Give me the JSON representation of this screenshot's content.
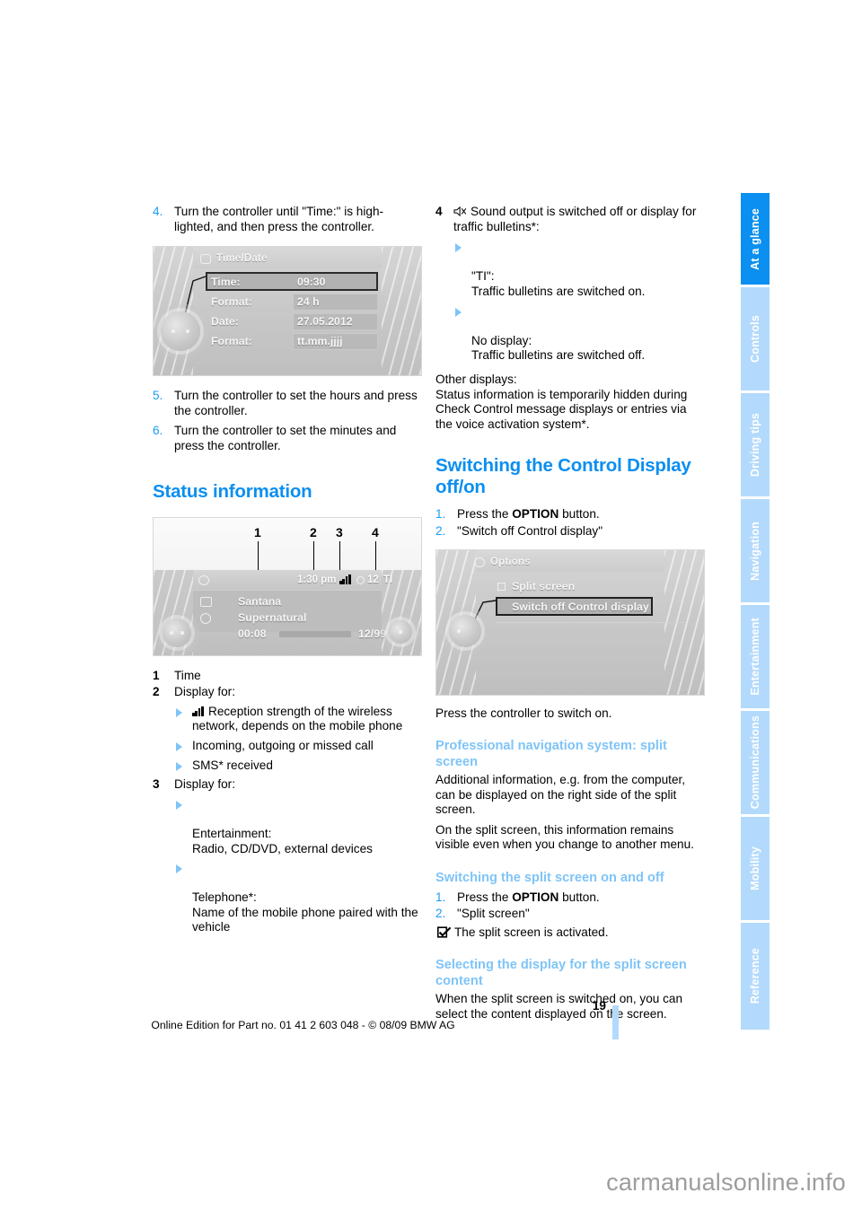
{
  "page": {
    "number": "19",
    "footer_line": "Online Edition for Part no. 01 41 2 603 048 - © 08/09 BMW AG",
    "watermark": "carmanualsonline.info"
  },
  "sidebar": {
    "tabs": [
      {
        "label": "At a glance",
        "active": true
      },
      {
        "label": "Controls",
        "active": false
      },
      {
        "label": "Driving tips",
        "active": false
      },
      {
        "label": "Navigation",
        "active": false
      },
      {
        "label": "Entertainment",
        "active": false
      },
      {
        "label": "Communications",
        "active": false
      },
      {
        "label": "Mobility",
        "active": false
      },
      {
        "label": "Reference",
        "active": false
      }
    ]
  },
  "left_column": {
    "step4": {
      "num": "4.",
      "text": "Turn the controller until \"Time:\" is high-lighted, and then press the controller."
    },
    "figure_timedate": {
      "title": "Time/Date",
      "rows": [
        {
          "label": "Time:",
          "value": "09:30",
          "selected": true
        },
        {
          "label": "Format:",
          "value": "24 h",
          "selected": false
        },
        {
          "label": "Date:",
          "value": "27.05.2012",
          "selected": false
        },
        {
          "label": "Format:",
          "value": "tt.mm.jjjj",
          "selected": false
        }
      ]
    },
    "step5": {
      "num": "5.",
      "text": "Turn the controller to set the hours and press the controller."
    },
    "step6": {
      "num": "6.",
      "text": "Turn the controller to set the minutes and press the controller."
    },
    "heading_status": "Status information",
    "figure_status": {
      "callouts": [
        "1",
        "2",
        "3",
        "4"
      ],
      "time": "1:30 pm",
      "temperature": "12",
      "ti_label": "TI",
      "artist": "Santana",
      "track": "Supernatural",
      "elapsed": "00:08",
      "position": "12/99"
    },
    "keys": [
      {
        "num": "1",
        "text": "Time",
        "bullets": []
      },
      {
        "num": "2",
        "text": "Display for:",
        "bullets": [
          {
            "icon": "signal-bars-icon",
            "text": "Reception strength of the wireless network, depends on the mobile phone"
          },
          {
            "icon": "",
            "text": "Incoming, outgoing or missed call"
          },
          {
            "icon": "",
            "text": "SMS* received"
          }
        ]
      },
      {
        "num": "3",
        "text": "Display for:",
        "bullets": [
          {
            "icon": "",
            "text": "Entertainment:\nRadio, CD/DVD, external devices"
          },
          {
            "icon": "",
            "text": "Telephone*:\nName of the mobile phone paired with the vehicle"
          }
        ]
      }
    ]
  },
  "right_column": {
    "key4": {
      "num": "4",
      "icon": "speaker-mute-icon",
      "text": "Sound output is switched off or display for traffic bulletins*:",
      "bullets": [
        {
          "text": "\"TI\":\nTraffic bulletins are switched on."
        },
        {
          "text": "No display:\nTraffic bulletins are switched off."
        }
      ]
    },
    "other_displays": {
      "lead": "Other displays:",
      "body": "Status information is temporarily hidden during Check Control message displays or entries via the voice activation system*."
    },
    "heading_switching": "Switching the Control Display off/on",
    "steps": [
      {
        "num": "1.",
        "pre": "Press the ",
        "bold": "OPTION",
        "post": " button."
      },
      {
        "num": "2.",
        "pre": "\"Switch off Control display\"",
        "bold": "",
        "post": ""
      }
    ],
    "figure_options": {
      "title": "Options",
      "item_split": "Split screen",
      "item_switch_off": "Switch off Control display"
    },
    "press_controller": "Press the controller to switch on.",
    "subhead_profnav": "Professional navigation system: split screen",
    "profnav_p1": "Additional information, e.g. from the computer, can be displayed on the right side of the split screen.",
    "profnav_p2": "On the split screen, this information remains visible even when you change to another menu.",
    "subhead_switching_split": "Switching the split screen on and off",
    "split_steps": [
      {
        "num": "1.",
        "pre": "Press the ",
        "bold": "OPTION",
        "post": " button."
      },
      {
        "num": "2.",
        "pre": "\"Split screen\"",
        "bold": "",
        "post": ""
      }
    ],
    "split_result": "The split screen is activated.",
    "subhead_selecting": "Selecting the display for the split screen content",
    "selecting_body": "When the split screen is switched on, you can select the content displayed on the screen."
  }
}
